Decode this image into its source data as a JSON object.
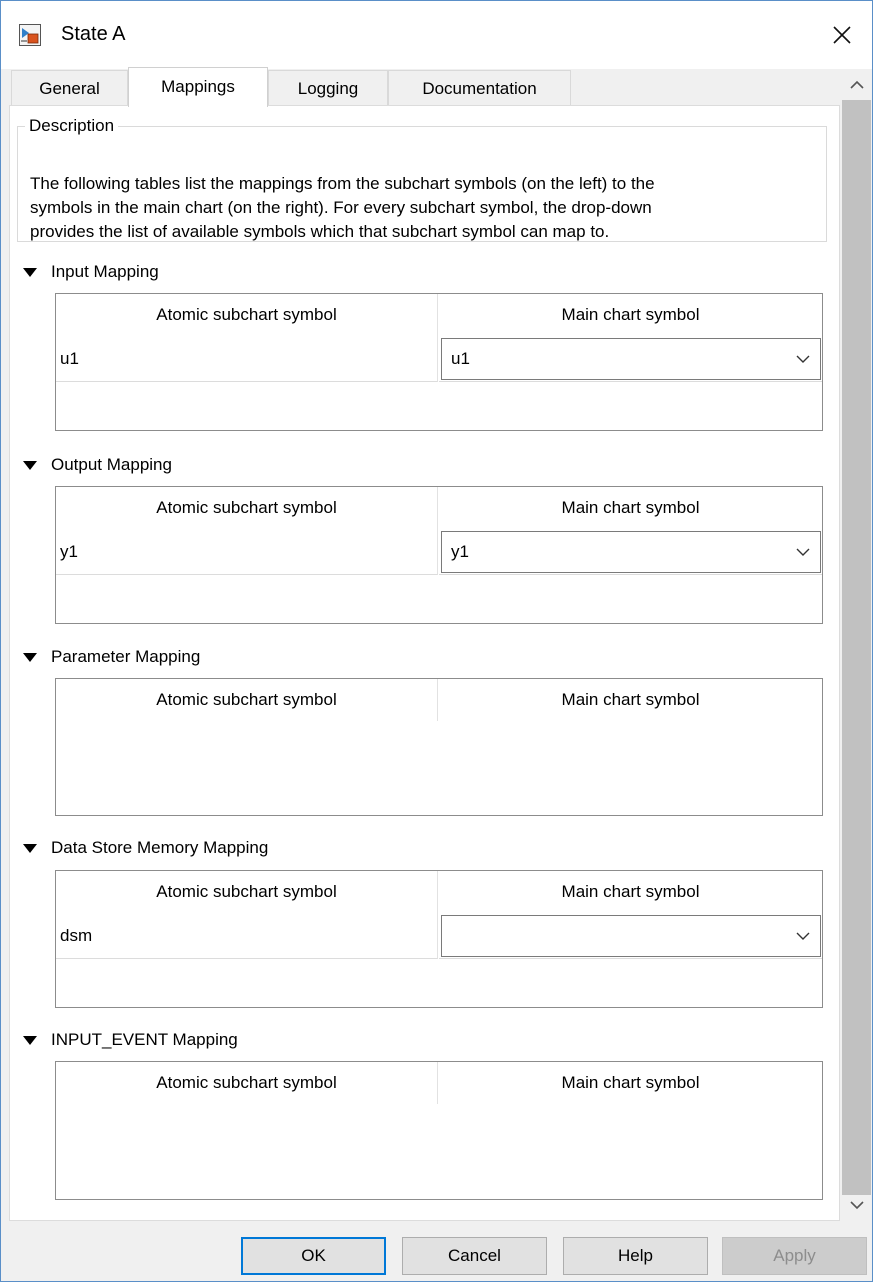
{
  "window": {
    "title": "State A",
    "app_icon": "stateflow-icon",
    "close_icon": "close-icon"
  },
  "tabs": [
    {
      "label": "General",
      "active": false
    },
    {
      "label": "Mappings",
      "active": true
    },
    {
      "label": "Logging",
      "active": false
    },
    {
      "label": "Documentation",
      "active": false
    }
  ],
  "description": {
    "label": "Description",
    "lines": [
      "The following tables list the mappings from the subchart symbols (on the left) to the",
      "symbols in the main chart (on the right). For every subchart symbol, the drop-down",
      "provides the list of available symbols which that subchart symbol can map to."
    ]
  },
  "sections": [
    {
      "title": "Input Mapping",
      "col_left": "Atomic subchart symbol",
      "col_right": "Main chart symbol",
      "rows": [
        {
          "symbol": "u1",
          "value": "u1"
        }
      ]
    },
    {
      "title": "Output Mapping",
      "col_left": "Atomic subchart symbol",
      "col_right": "Main chart symbol",
      "rows": [
        {
          "symbol": "y1",
          "value": "y1"
        }
      ]
    },
    {
      "title": "Parameter Mapping",
      "col_left": "Atomic subchart symbol",
      "col_right": "Main chart symbol",
      "rows": []
    },
    {
      "title": "Data Store Memory Mapping",
      "col_left": "Atomic subchart symbol",
      "col_right": "Main chart symbol",
      "rows": [
        {
          "symbol": "dsm",
          "value": ""
        }
      ]
    },
    {
      "title": "INPUT_EVENT Mapping",
      "col_left": "Atomic subchart symbol",
      "col_right": "Main chart symbol",
      "rows": []
    }
  ],
  "buttons": {
    "ok": "OK",
    "cancel": "Cancel",
    "help": "Help",
    "apply": "Apply"
  },
  "icons": {
    "scroll_up": "chevron-up-icon",
    "scroll_down": "chevron-down-icon",
    "section_toggle": "triangle-down-icon"
  },
  "colors": {
    "primary_border": "#0078d7",
    "window_border": "#5a8fc8"
  }
}
